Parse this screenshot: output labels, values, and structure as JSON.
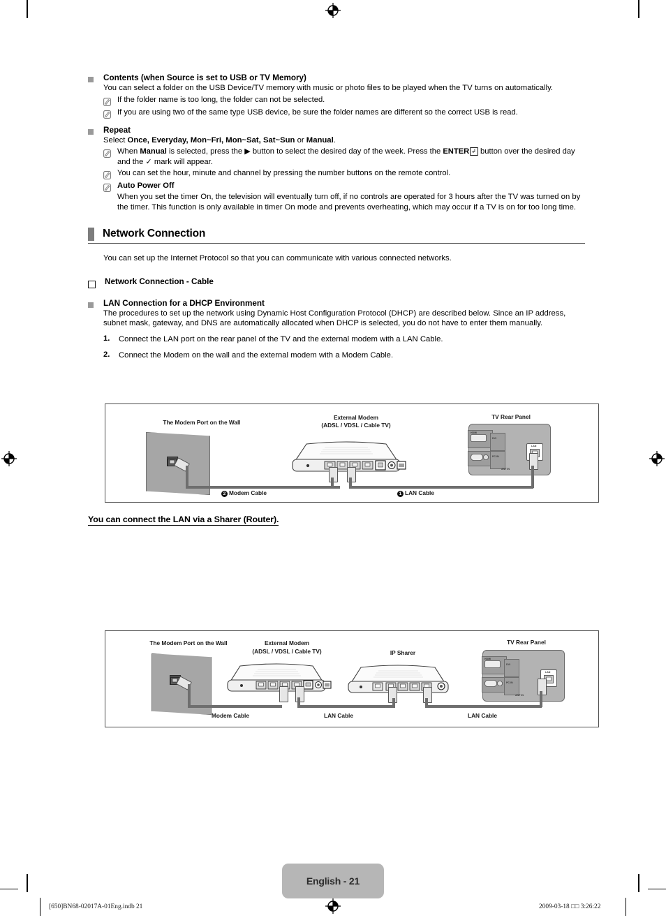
{
  "document": {
    "language_tag": "English - 21",
    "footer_left": "[650]BN68-02017A-01Eng.indb   21",
    "footer_right": "2009-03-18   □□ 3:26:22"
  },
  "sections": {
    "contents": {
      "heading": "Contents (when Source is set to USB or TV Memory)",
      "body": "You can select a folder on the USB Device/TV memory with music or photo files to be played when the TV turns on automatically.",
      "notes": [
        "If the folder name is too long, the folder can not be selected.",
        "If you are using two of the same type USB device, be sure the folder names are different so the correct USB is read."
      ]
    },
    "repeat": {
      "heading": "Repeat",
      "select_prefix": "Select ",
      "select_options": "Once, Everyday, Mon~Fri, Mon~Sat, Sat~Sun",
      "select_or": " or ",
      "select_manual": "Manual",
      "select_suffix": ".",
      "note1_a": "When ",
      "note1_manual": "Manual",
      "note1_b": " is selected, press the ▶ button to select the desired day of the week. Press the ",
      "note1_enter": "ENTER",
      "note1_enter_glyph": "↲",
      "note1_c": " button over the desired day and the ",
      "note1_check": "✓",
      "note1_d": " mark will appear.",
      "note2": "You can set the hour, minute and channel by pressing the number buttons on the remote control.",
      "note3_title": "Auto Power Off",
      "note3_body": "When you set the timer On, the television will eventually turn off, if no controls are operated for 3 hours after the TV was turned on by the timer. This function is only available in timer On mode and prevents overheating, which may occur if a TV is on for too long time."
    },
    "network": {
      "title": "Network Connection",
      "intro": "You can set up the Internet Protocol so that you can communicate with various connected networks.",
      "subtitle": "Network Connection - Cable",
      "dhcp_heading": "LAN Connection for a DHCP Environment",
      "dhcp_body": "The procedures to set up the network using Dynamic Host Configuration Protocol (DHCP) are described below. Since an IP address, subnet mask, gateway, and DNS are automatically allocated when DHCP is selected, you do not have to enter them manually.",
      "steps": [
        {
          "num": "1.",
          "text": "Connect the LAN port on the rear panel of the TV and the external modem with a LAN Cable."
        },
        {
          "num": "2.",
          "text": "Connect the Modem on the wall and the external modem with a Modem Cable."
        }
      ],
      "sharer_heading": "You can connect the LAN via a Sharer (Router)."
    }
  },
  "figure1": {
    "wall_label": "The Modem Port on the Wall",
    "modem_label_l1": "External Modem",
    "modem_label_l2": "(ADSL / VDSL / Cable TV)",
    "tv_label": "TV Rear Panel",
    "tv_lan_port": "LAN",
    "cable_modem_num": "❷",
    "cable_modem": "Modem Cable",
    "cable_lan_num": "❶",
    "cable_lan": "LAN Cable"
  },
  "figure2": {
    "wall_label": "The Modem Port on the Wall",
    "modem_label_l1": "External Modem",
    "modem_label_l2": "(ADSL / VDSL / Cable TV)",
    "sharer_label": "IP Sharer",
    "tv_label": "TV Rear Panel",
    "tv_lan_port": "LAN",
    "cable_modem": "Modem Cable",
    "cable_lan_1": "LAN Cable",
    "cable_lan_2": "LAN Cable"
  },
  "colors": {
    "bullet_grey": "#9a9a9a",
    "section_bar": "#7d7d7d",
    "wall": "#a6a6a6",
    "tv_panel": "#b3b3b3",
    "cable": "#6e6e6e",
    "page_tag_bg": "#b6b6b6"
  }
}
